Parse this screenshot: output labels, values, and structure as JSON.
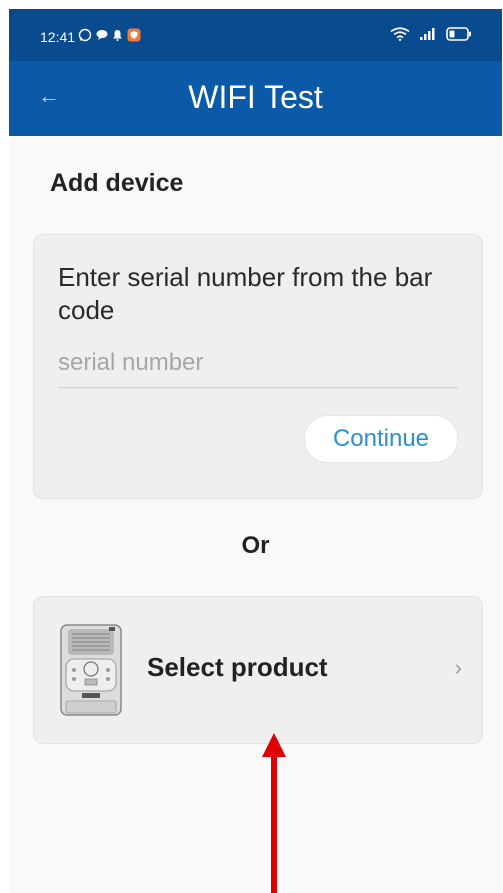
{
  "status_bar": {
    "time": "12:41",
    "background": "#0a4b8f",
    "left_icons": [
      "whatsapp-icon",
      "chat-icon",
      "notification-bell-icon",
      "shield-app-icon"
    ],
    "right_icons": [
      "wifi-icon",
      "signal-icon",
      "battery-icon"
    ]
  },
  "app_bar": {
    "title": "WIFI Test",
    "back_icon": "back-arrow-icon",
    "background": "#0a5aa8"
  },
  "section": {
    "title": "Add device"
  },
  "serial_card": {
    "label": "Enter serial number from the bar code",
    "input_value": "",
    "input_placeholder": "serial number",
    "continue_label": "Continue",
    "accent": "#2b8fd6"
  },
  "separator": {
    "text": "Or"
  },
  "product_card": {
    "label": "Select product",
    "image_icon": "device-product-image",
    "chevron_icon": "chevron-right-icon"
  },
  "annotation": {
    "icon": "red-arrow-up",
    "color": "#e00000"
  }
}
